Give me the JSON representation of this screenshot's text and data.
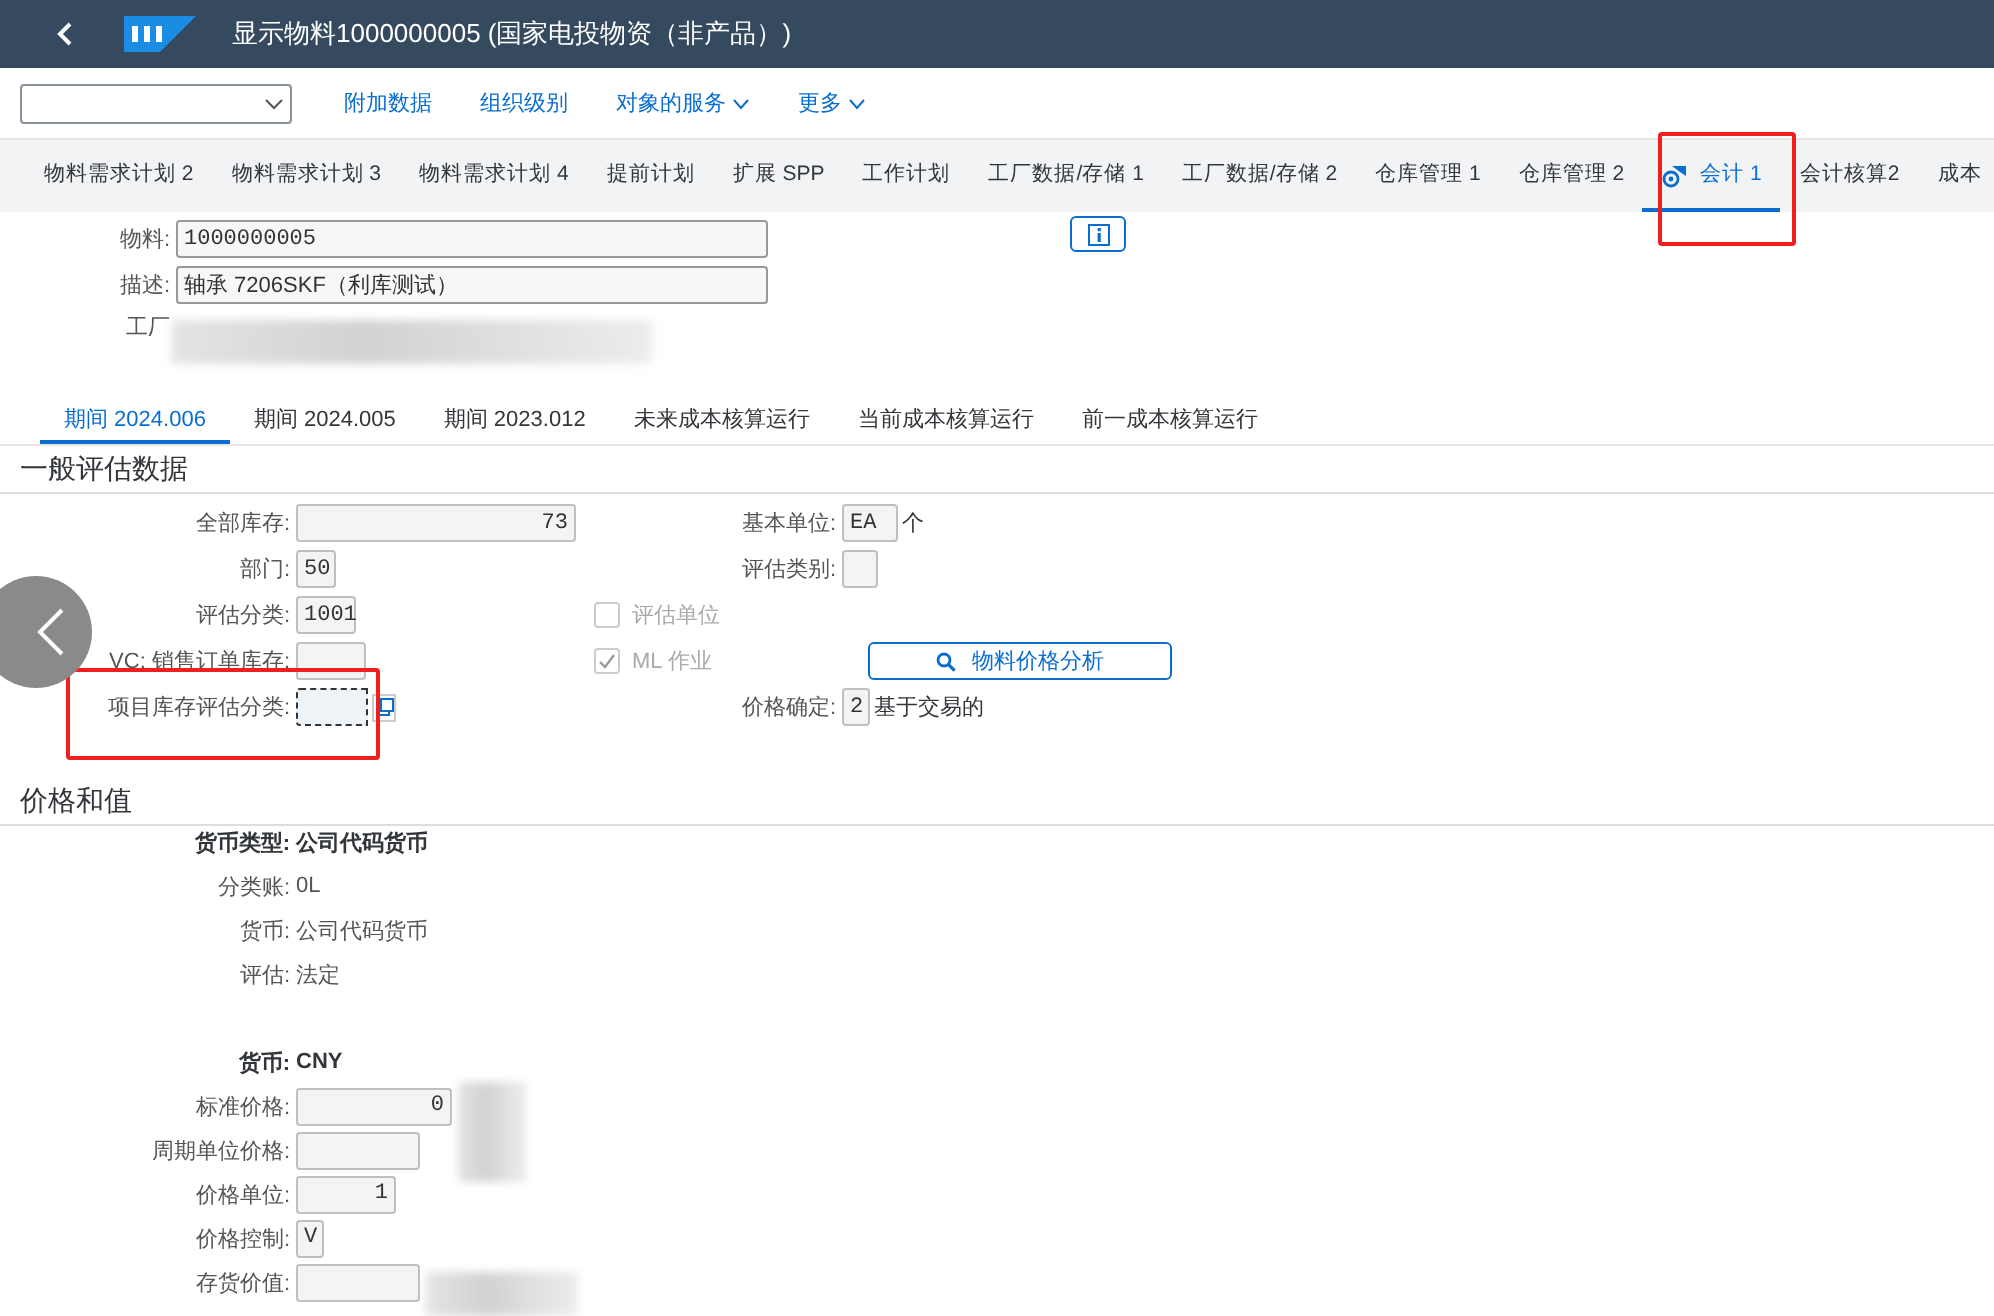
{
  "shell": {
    "title": "显示物料1000000005 (国家电投物资（非产品）)"
  },
  "toolbar": {
    "actions": [
      {
        "label": "附加数据",
        "has_menu": false
      },
      {
        "label": "组织级别",
        "has_menu": false
      },
      {
        "label": "对象的服务",
        "has_menu": true
      },
      {
        "label": "更多",
        "has_menu": true
      }
    ]
  },
  "tabs": [
    {
      "label": "物料需求计划 2",
      "selected": false
    },
    {
      "label": "物料需求计划 3",
      "selected": false
    },
    {
      "label": "物料需求计划 4",
      "selected": false
    },
    {
      "label": "提前计划",
      "selected": false
    },
    {
      "label": "扩展 SPP",
      "selected": false
    },
    {
      "label": "工作计划",
      "selected": false
    },
    {
      "label": "工厂数据/存储 1",
      "selected": false
    },
    {
      "label": "工厂数据/存储 2",
      "selected": false
    },
    {
      "label": "仓库管理 1",
      "selected": false
    },
    {
      "label": "仓库管理 2",
      "selected": false
    },
    {
      "label": "会计 1",
      "selected": true
    },
    {
      "label": "会计核算2",
      "selected": false
    },
    {
      "label": "成本",
      "selected": false
    }
  ],
  "header": {
    "fields": [
      {
        "label": "物料:",
        "value": "1000000005"
      },
      {
        "label": "描述:",
        "value": "轴承 7206SKF（利库测试）"
      },
      {
        "label": "工厂"
      }
    ]
  },
  "subtabs": [
    {
      "label": "期间 2024.006",
      "selected": true
    },
    {
      "label": "期间 2024.005",
      "selected": false
    },
    {
      "label": "期间 2023.012",
      "selected": false
    },
    {
      "label": "未来成本核算运行",
      "selected": false
    },
    {
      "label": "当前成本核算运行",
      "selected": false
    },
    {
      "label": "前一成本核算运行",
      "selected": false
    }
  ],
  "general": {
    "title": "一般评估数据",
    "rows": [
      {
        "left": {
          "label": "全部库存:",
          "value": "73"
        },
        "right": {
          "label": "基本单位:",
          "value": "EA",
          "suffix": "个"
        }
      },
      {
        "left": {
          "label": "部门:",
          "value": "50"
        },
        "right": {
          "label": "评估类别:"
        }
      },
      {
        "left": {
          "label": "评估分类:",
          "value": "1001"
        },
        "middle": {
          "label": "评估单位",
          "checked": false,
          "disabled": true
        }
      },
      {
        "left": {
          "label": "VC: 销售订单库存:"
        },
        "middle": {
          "label": "ML 作业",
          "checked": true,
          "disabled": true
        },
        "button": {
          "label": "物料价格分析"
        }
      },
      {
        "left": {
          "label": "项目库存评估分类:",
          "focused": true,
          "value_help": true
        },
        "right": {
          "label": "价格确定:",
          "value": "2",
          "suffix": "基于交易的"
        }
      }
    ]
  },
  "price": {
    "title": "价格和值",
    "info": [
      {
        "label": "货币类型:",
        "value": "公司代码货币",
        "emphasis": true
      },
      {
        "label": "分类账:",
        "value": "0L",
        "emphasis": false
      },
      {
        "label": "货币:",
        "value": "公司代码货币",
        "emphasis": false
      },
      {
        "label": "评估:",
        "value": "法定",
        "emphasis": false
      }
    ],
    "currency": {
      "label": "货币:",
      "value": "CNY",
      "emphasis": true
    },
    "fields": [
      {
        "label": "标准价格:",
        "value": "0"
      },
      {
        "label": "周期单位价格:"
      },
      {
        "label": "价格单位:",
        "value": "1"
      },
      {
        "label": "价格控制:",
        "value": "V"
      },
      {
        "label": "存货价值:"
      }
    ]
  }
}
